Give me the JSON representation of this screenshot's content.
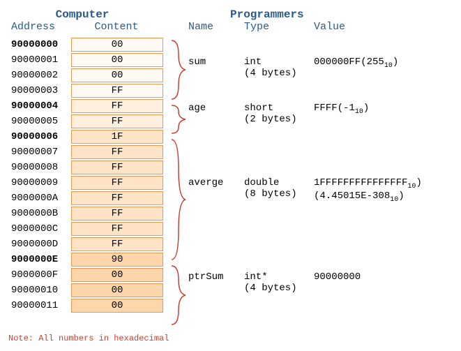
{
  "headers": {
    "computer": "Computer",
    "programmers": "Programmers",
    "address": "Address",
    "content": "Content",
    "name": "Name",
    "type": "Type",
    "value": "Value"
  },
  "rows": [
    {
      "addr": "90000000",
      "content": "00",
      "bold": true,
      "shade": 0
    },
    {
      "addr": "90000001",
      "content": "00",
      "bold": false,
      "shade": 0
    },
    {
      "addr": "90000002",
      "content": "00",
      "bold": false,
      "shade": 0
    },
    {
      "addr": "90000003",
      "content": "FF",
      "bold": false,
      "shade": 0
    },
    {
      "addr": "90000004",
      "content": "FF",
      "bold": true,
      "shade": 1
    },
    {
      "addr": "90000005",
      "content": "FF",
      "bold": false,
      "shade": 1
    },
    {
      "addr": "90000006",
      "content": "1F",
      "bold": true,
      "shade": 2
    },
    {
      "addr": "90000007",
      "content": "FF",
      "bold": false,
      "shade": 2
    },
    {
      "addr": "90000008",
      "content": "FF",
      "bold": false,
      "shade": 2
    },
    {
      "addr": "90000009",
      "content": "FF",
      "bold": false,
      "shade": 2
    },
    {
      "addr": "9000000A",
      "content": "FF",
      "bold": false,
      "shade": 2
    },
    {
      "addr": "9000000B",
      "content": "FF",
      "bold": false,
      "shade": 2
    },
    {
      "addr": "9000000C",
      "content": "FF",
      "bold": false,
      "shade": 2
    },
    {
      "addr": "9000000D",
      "content": "FF",
      "bold": false,
      "shade": 2
    },
    {
      "addr": "9000000E",
      "content": "90",
      "bold": true,
      "shade": 3
    },
    {
      "addr": "9000000F",
      "content": "00",
      "bold": false,
      "shade": 3
    },
    {
      "addr": "90000010",
      "content": "00",
      "bold": false,
      "shade": 3
    },
    {
      "addr": "90000011",
      "content": "00",
      "bold": false,
      "shade": 3
    }
  ],
  "groups": [
    {
      "name": "sum",
      "type": "int",
      "bytes": "(4 bytes)",
      "value": "000000FF(255",
      "sub": "10",
      "valueEnd": ")",
      "span": 4
    },
    {
      "name": "age",
      "type": "short",
      "bytes": "(2 bytes)",
      "value": "FFFF(-1",
      "sub": "10",
      "valueEnd": ")",
      "span": 2
    },
    {
      "name": "averge",
      "type": "double",
      "bytes": "(8 bytes)",
      "value": "1FFFFFFFFFFFFFFF",
      "value2": "(4.45015E-308",
      "sub": "10",
      "valueEnd": ")",
      "span": 8
    },
    {
      "name": "ptrSum",
      "type": "int*",
      "bytes": "(4 bytes)",
      "value": "90000000",
      "span": 4
    }
  ],
  "note": "Note: All numbers in hexadecimal"
}
